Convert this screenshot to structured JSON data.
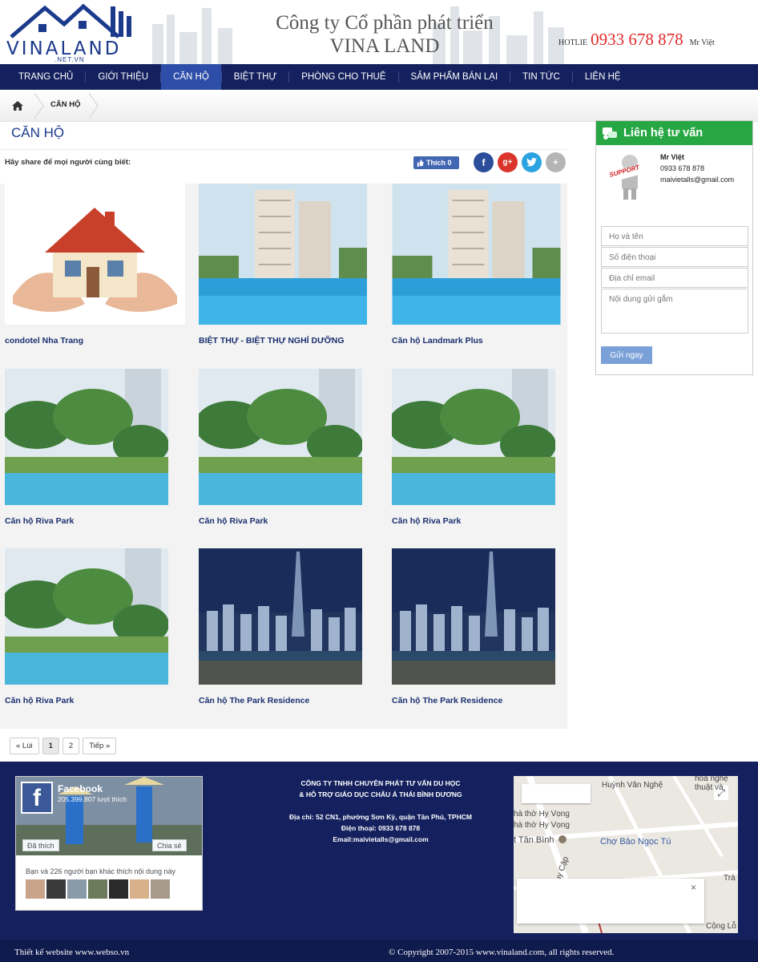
{
  "header": {
    "logo_text": "VINALAND",
    "logo_sub": ".NET.VN",
    "company_line1": "Công ty Cổ phần phát triển",
    "company_line2": "VINA LAND",
    "hotline_label": "HOTLIE",
    "hotline_number": "0933 678 878",
    "hotline_person": "Mr Việt"
  },
  "nav": {
    "items": [
      "TRANG CHỦ",
      "GIỚI THIỆU",
      "CĂN HỘ",
      "BIỆT THỰ",
      "PHÒNG CHO THUÊ",
      "SẢM PHẨM BÁN LẠI",
      "TIN TỨC",
      "LIÊN HỆ"
    ],
    "active": "CĂN HỘ"
  },
  "breadcrumb": {
    "current": "CĂN HỘ"
  },
  "page": {
    "title": "CĂN HỘ",
    "share_text": "Hãy share để mọi người cùng biết:",
    "like_label": "Thích 0"
  },
  "products": [
    {
      "name": "condotel Nha Trang",
      "image": "house-in-hands"
    },
    {
      "name": "BIỆT THỰ - BIỆT THỰ NGHỈ DƯỠNG",
      "image": "pool-tower"
    },
    {
      "name": "Căn hộ Landmark Plus",
      "image": "pool-tower"
    },
    {
      "name": "Căn hộ Riva Park",
      "image": "palm-pool"
    },
    {
      "name": "Căn hộ Riva Park",
      "image": "palm-pool"
    },
    {
      "name": "Căn hộ Riva Park",
      "image": "palm-pool"
    },
    {
      "name": "Căn hộ Riva Park",
      "image": "palm-pool"
    },
    {
      "name": "Căn hộ The Park Residence",
      "image": "night-skyline"
    },
    {
      "name": "Căn hộ The Park Residence",
      "image": "night-skyline"
    }
  ],
  "pager": {
    "prev": "« Lùi",
    "pages": [
      "1",
      "2"
    ],
    "current": "1",
    "next": "Tiếp »"
  },
  "sidebar": {
    "title": "Liên hệ tư vấn",
    "support_badge": "SUPPORT",
    "contact_name": "Mr Việt",
    "contact_phone": "0933 678 878",
    "contact_email": "maivietalls@gmail.com",
    "placeholders": {
      "name": "Họ và tên",
      "phone": "Số điện thoại",
      "email": "Địa chỉ email",
      "message": "Nội dung gửi gắm"
    },
    "submit": "Gửi ngay"
  },
  "footer": {
    "fb_page": "Facebook",
    "fb_likes": "205.399.807 lượt thích",
    "fb_like_btn": "Đã thích",
    "fb_share_btn": "Chia sẻ",
    "fb_friends": "Bạn và 226 người bạn khác thích nội dung này",
    "company_line1": "CÔNG TY TNHH CHUYÊN PHÁT TƯ VẤN DU HỌC",
    "company_line2": "& HỖ TRỢ GIÁO DỤC CHÂU Á THÁI BÌNH DƯƠNG",
    "address": "Địa chỉ: 52 CN1,  phường Sơn Kỳ, quận Tân Phú, TPHCM",
    "phone": "Điện thoại: 0933 678 878",
    "email": "Email:maivietalls@gmail.com",
    "map_labels": [
      "Huỳnh Văn Nghệ",
      "hòa nghệ thuật và",
      "hà thờ Hy Vọng",
      "hà thờ Hy Vọng",
      "t Tân Bình",
      "Chợ Bảo Ngọc Tú",
      "Huy Cập",
      "Trà",
      "Cộng Lỗ"
    ],
    "designer": "Thiết kế website www.webso.vn",
    "copyright": "© Copyright 2007-2015 www.vinaland.com, all rights reserved."
  },
  "colors": {
    "nav": "#14215e",
    "nav_active": "#2d4da8",
    "accent_green": "#27a744",
    "hotline": "#e02a2a",
    "title": "#1b3a8c"
  }
}
